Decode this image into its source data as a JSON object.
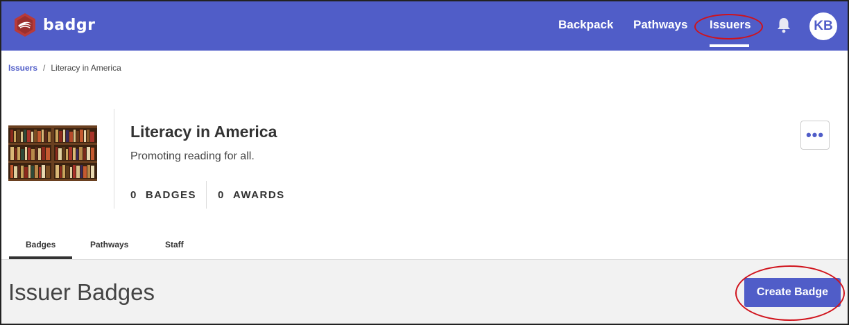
{
  "nav": {
    "logo_text": "badgr",
    "items": [
      {
        "label": "Backpack"
      },
      {
        "label": "Pathways"
      },
      {
        "label": "Issuers"
      }
    ],
    "avatar_initials": "KB",
    "accent_color": "#505dc8",
    "highlight_color": "#d0121b"
  },
  "breadcrumb": {
    "parent": "Issuers",
    "separator": "/",
    "current": "Literacy in America"
  },
  "issuer": {
    "name": "Literacy in America",
    "description": "Promoting reading for all.",
    "badges_count": "0",
    "badges_label": "BADGES",
    "awards_count": "0",
    "awards_label": "AWARDS",
    "more_label": "•••",
    "image_icon": "bookshelf-image"
  },
  "tabs": [
    {
      "label": "Badges",
      "active": true
    },
    {
      "label": "Pathways",
      "active": false
    },
    {
      "label": "Staff",
      "active": false
    }
  ],
  "section": {
    "title": "Issuer Badges",
    "create_button": "Create Badge"
  }
}
